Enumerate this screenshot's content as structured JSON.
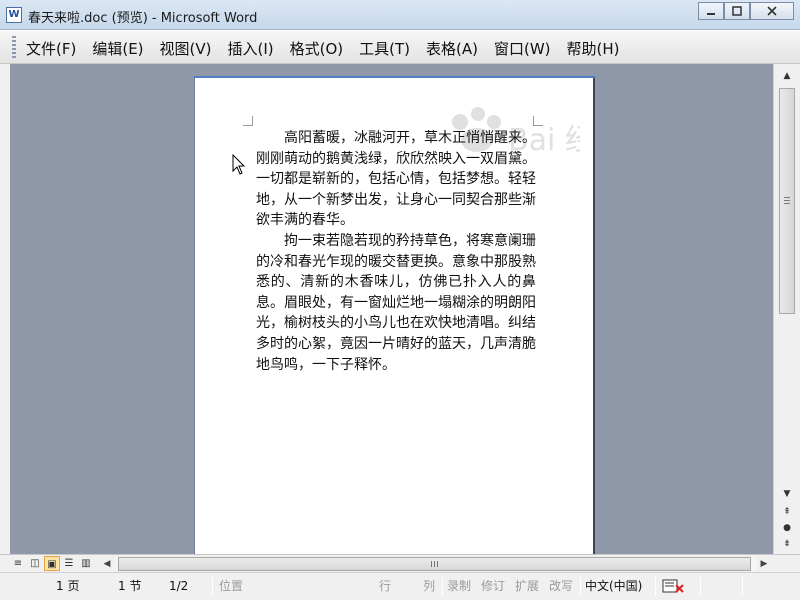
{
  "window": {
    "title": "春天来啦.doc (预览) - Microsoft Word",
    "icon_label": "W"
  },
  "menu": {
    "items": [
      "文件(F)",
      "编辑(E)",
      "视图(V)",
      "插入(I)",
      "格式(O)",
      "工具(T)",
      "表格(A)",
      "窗口(W)",
      "帮助(H)"
    ]
  },
  "document": {
    "paragraphs": [
      "高阳蓄暖，冰融河开，草木正悄悄醒来。刚刚萌动的鹅黄浅绿，欣欣然映入一双眉黛。一切都是崭新的，包括心情，包括梦想。轻轻地，从一个新梦出发，让身心一同契合那些渐欲丰满的春华。",
      "拘一束若隐若现的矜持草色，将寒意阑珊的冷和春光乍现的暖交替更换。意象中那股熟悉的、清新的木香味儿，仿佛已扑入人的鼻息。眉眼处，有一窗灿烂地一塌糊涂的明朗阳光，榆树枝头的小鸟儿也在欢快地清唱。纠结多时的心絮，竟因一片晴好的蓝天，几声清脆地鸟鸣，一下子释怀。"
    ],
    "watermark": "Bai 经验"
  },
  "statusbar": {
    "page": "1 页",
    "section": "1 节",
    "page_of": "1/2",
    "position": "位置",
    "line": "行",
    "column": "列",
    "record": "录制",
    "revision": "修订",
    "extend": "扩展",
    "overtype": "改写",
    "language": "中文(中国)"
  },
  "colors": {
    "doc_background": "#8e98a9",
    "page": "#ffffff",
    "active_view": "#ffe4a8"
  }
}
